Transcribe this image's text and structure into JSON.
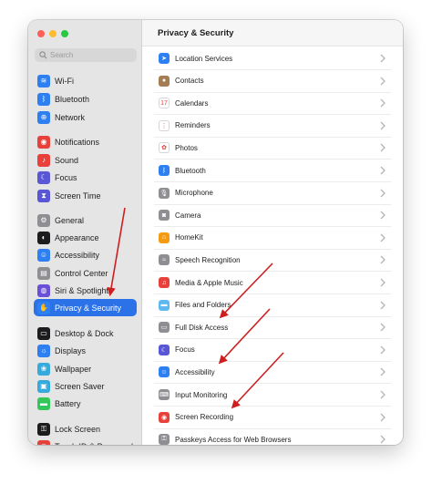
{
  "sidebar": {
    "search": {
      "placeholder": "Search"
    },
    "items": [
      {
        "label": "Wi-Fi",
        "icon": "wifi-icon",
        "color": "#2d7ff2",
        "glyph": "≋"
      },
      {
        "label": "Bluetooth",
        "icon": "bluetooth-icon",
        "color": "#2d7ff2",
        "glyph": "ᛒ"
      },
      {
        "label": "Network",
        "icon": "globe-icon",
        "color": "#2d7ff2",
        "glyph": "⊕"
      },
      {
        "label": "Notifications",
        "icon": "bell-icon",
        "color": "#e8413c",
        "glyph": "◉"
      },
      {
        "label": "Sound",
        "icon": "speaker-icon",
        "color": "#e8413c",
        "glyph": "♪"
      },
      {
        "label": "Focus",
        "icon": "moon-icon",
        "color": "#5a57d6",
        "glyph": "☾"
      },
      {
        "label": "Screen Time",
        "icon": "hourglass-icon",
        "color": "#5a57d6",
        "glyph": "⧗"
      },
      {
        "label": "General",
        "icon": "gear-icon",
        "color": "#8e8e93",
        "glyph": "⚙"
      },
      {
        "label": "Appearance",
        "icon": "appearance-icon",
        "color": "#1c1c1e",
        "glyph": "◐"
      },
      {
        "label": "Accessibility",
        "icon": "accessibility-icon",
        "color": "#2d7ff2",
        "glyph": "☺"
      },
      {
        "label": "Control Center",
        "icon": "control-center-icon",
        "color": "#8e8e93",
        "glyph": "▤"
      },
      {
        "label": "Siri & Spotlight",
        "icon": "siri-icon",
        "color": "#6b4fd8",
        "glyph": "◍"
      },
      {
        "label": "Privacy & Security",
        "icon": "hand-icon",
        "color": "#2d7ff2",
        "glyph": "✋"
      },
      {
        "label": "Desktop & Dock",
        "icon": "desktop-icon",
        "color": "#1c1c1e",
        "glyph": "▭"
      },
      {
        "label": "Displays",
        "icon": "display-icon",
        "color": "#2d7ff2",
        "glyph": "☼"
      },
      {
        "label": "Wallpaper",
        "icon": "wallpaper-icon",
        "color": "#36aadc",
        "glyph": "❀"
      },
      {
        "label": "Screen Saver",
        "icon": "screen-saver-icon",
        "color": "#36aadc",
        "glyph": "▣"
      },
      {
        "label": "Battery",
        "icon": "battery-icon",
        "color": "#33c759",
        "glyph": "▬"
      },
      {
        "label": "Lock Screen",
        "icon": "lock-icon",
        "color": "#1c1c1e",
        "glyph": "⚿"
      },
      {
        "label": "Touch ID & Password",
        "icon": "fingerprint-icon",
        "color": "#e8413c",
        "glyph": "◎"
      }
    ]
  },
  "main": {
    "title": "Privacy & Security",
    "rows": [
      {
        "label": "Location Services",
        "icon": "location-icon",
        "color": "#2d7ff2",
        "glyph": "➤"
      },
      {
        "label": "Contacts",
        "icon": "contacts-icon",
        "color": "#a67c52",
        "glyph": "●"
      },
      {
        "label": "Calendars",
        "icon": "calendar-icon",
        "color": "#ffffff",
        "glyph": "17"
      },
      {
        "label": "Reminders",
        "icon": "reminders-icon",
        "color": "#ffffff",
        "glyph": "⋮"
      },
      {
        "label": "Photos",
        "icon": "photos-icon",
        "color": "#ffffff",
        "glyph": "✿"
      },
      {
        "label": "Bluetooth",
        "icon": "bluetooth-icon",
        "color": "#2d7ff2",
        "glyph": "ᛒ"
      },
      {
        "label": "Microphone",
        "icon": "microphone-icon",
        "color": "#8e8e93",
        "glyph": "🎙"
      },
      {
        "label": "Camera",
        "icon": "camera-icon",
        "color": "#8e8e93",
        "glyph": "◙"
      },
      {
        "label": "HomeKit",
        "icon": "home-icon",
        "color": "#f39c12",
        "glyph": "⌂"
      },
      {
        "label": "Speech Recognition",
        "icon": "speech-icon",
        "color": "#8e8e93",
        "glyph": "≈"
      },
      {
        "label": "Media & Apple Music",
        "icon": "music-icon",
        "color": "#e8413c",
        "glyph": "♫"
      },
      {
        "label": "Files and Folders",
        "icon": "folder-icon",
        "color": "#5fb8f0",
        "glyph": "▬"
      },
      {
        "label": "Full Disk Access",
        "icon": "disk-icon",
        "color": "#8e8e93",
        "glyph": "▭"
      },
      {
        "label": "Focus",
        "icon": "moon-icon",
        "color": "#5a57d6",
        "glyph": "☾"
      },
      {
        "label": "Accessibility",
        "icon": "accessibility-icon",
        "color": "#2d7ff2",
        "glyph": "☺"
      },
      {
        "label": "Input Monitoring",
        "icon": "keyboard-icon",
        "color": "#8e8e93",
        "glyph": "⌨"
      },
      {
        "label": "Screen Recording",
        "icon": "screen-recording-icon",
        "color": "#e8413c",
        "glyph": "◉"
      },
      {
        "label": "Passkeys Access for Web Browsers",
        "icon": "passkey-icon",
        "color": "#8e8e93",
        "glyph": "⚿"
      }
    ]
  },
  "colors": {
    "accent": "#2b72e8",
    "annotation_arrow": "#cc1f1f"
  }
}
